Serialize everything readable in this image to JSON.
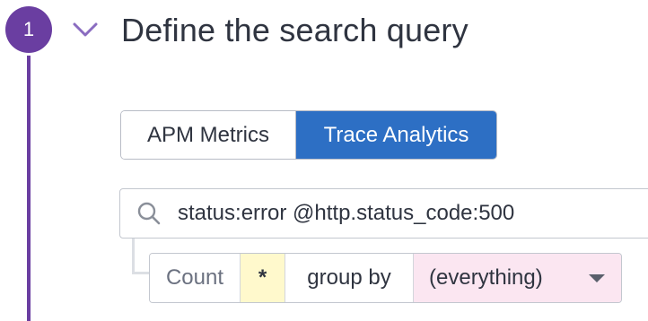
{
  "step": {
    "number": "1",
    "title": "Define the search query",
    "accent_color": "#6a3ea1"
  },
  "source_toggle": {
    "options": [
      "APM Metrics",
      "Trace Analytics"
    ],
    "selected": "Trace Analytics",
    "selected_color": "#2d6fc4"
  },
  "search": {
    "icon": "search-icon",
    "query": "status:error @http.status_code:500"
  },
  "aggregation": {
    "function": "Count",
    "measure": "*",
    "group_by_label": "group by",
    "group_by_value": "(everything)"
  }
}
